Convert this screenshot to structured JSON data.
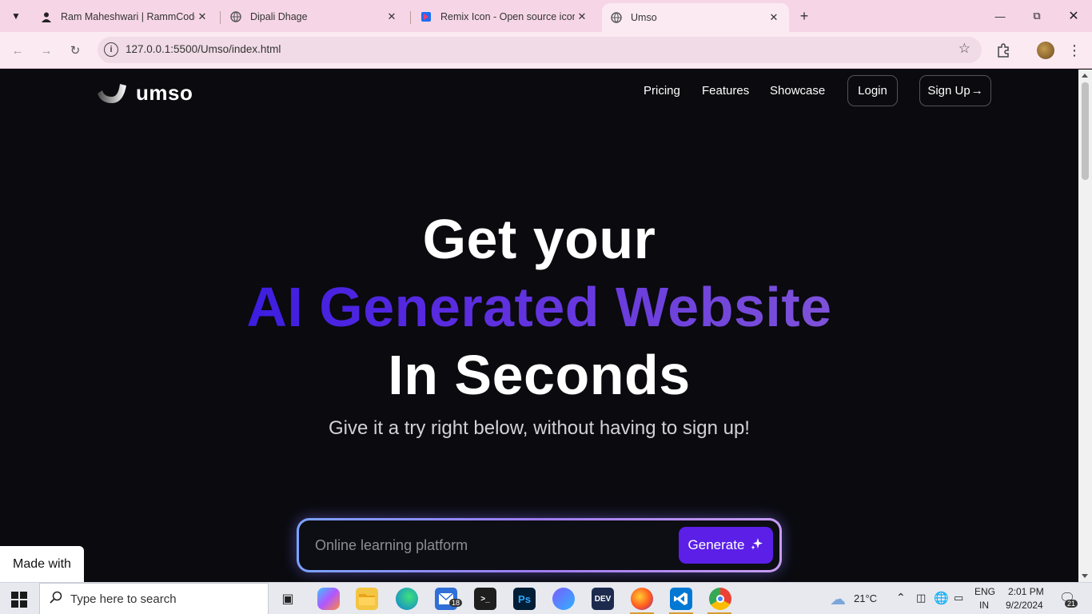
{
  "browser": {
    "tabs": [
      {
        "title": "Ram Maheshwari | RammCodes",
        "icon": "person-favicon-icon",
        "active": false
      },
      {
        "title": "Dipali Dhage",
        "icon": "globe-icon",
        "active": false
      },
      {
        "title": "Remix Icon - Open source icon",
        "icon": "remix-favicon-icon",
        "active": false
      },
      {
        "title": "Umso",
        "icon": "globe-icon",
        "active": true
      }
    ],
    "url": "127.0.0.1:5500/Umso/index.html"
  },
  "page": {
    "logo_text": "umso",
    "nav": {
      "pricing": "Pricing",
      "features": "Features",
      "showcase": "Showcase",
      "login": "Login",
      "signup": "Sign Up"
    },
    "hero": {
      "line1": "Get your",
      "line2": "AI Generated Website",
      "line3": "In Seconds",
      "subtitle": "Give it a try right below, without having to sign up!"
    },
    "generator": {
      "placeholder": "Online learning platform",
      "button": "Generate"
    },
    "made_with": "Made with",
    "colors": {
      "background": "#0a0a0f",
      "accent": "#5b1fe8",
      "gradient_start": "#3c1de0",
      "gradient_end": "#7e52d9"
    }
  },
  "taskbar": {
    "search_placeholder": "Type here to search",
    "weather": "21°C",
    "language_top": "ENG",
    "language_bottom": "IN",
    "time": "2:01 PM",
    "date": "9/2/2024",
    "mail_badge": "18",
    "notification_badge": "21",
    "apps": [
      "task-view-icon",
      "copilot-icon",
      "file-explorer-icon",
      "edge-icon",
      "mail-icon",
      "terminal-icon",
      "photoshop-icon",
      "power-automate-icon",
      "devtoys-icon",
      "firefox-icon",
      "vscode-icon",
      "chrome-icon"
    ]
  }
}
